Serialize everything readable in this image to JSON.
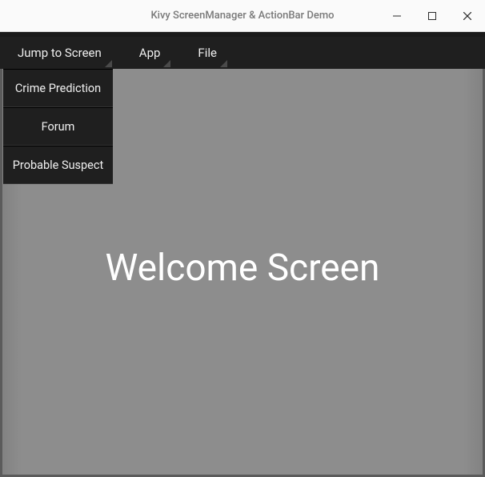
{
  "window": {
    "title": "Kivy ScreenManager & ActionBar Demo"
  },
  "actionbar": {
    "items": [
      {
        "label": "Jump to Screen"
      },
      {
        "label": "App"
      },
      {
        "label": "File"
      }
    ]
  },
  "dropdown": {
    "items": [
      {
        "label": "Crime Prediction"
      },
      {
        "label": "Forum"
      },
      {
        "label": "Probable Suspect"
      }
    ]
  },
  "main": {
    "heading": "Welcome Screen"
  }
}
